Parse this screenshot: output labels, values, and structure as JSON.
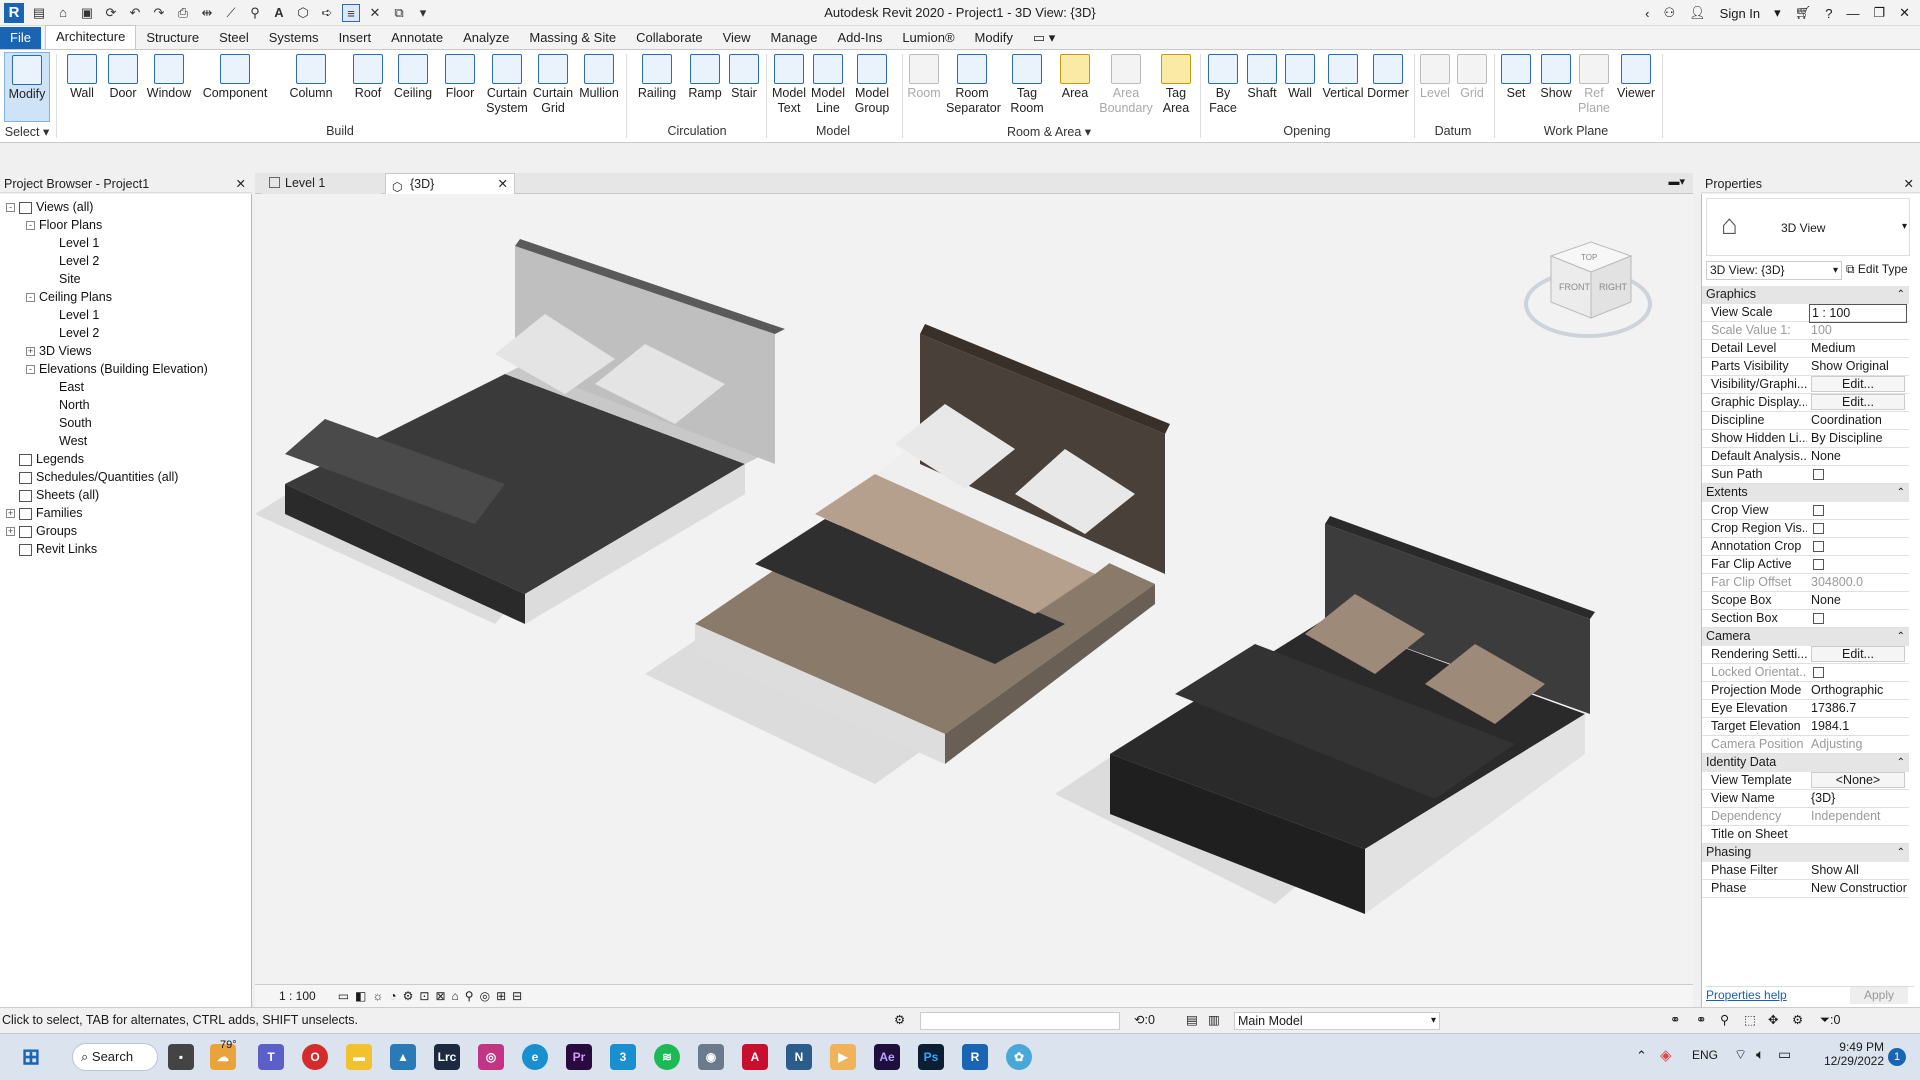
{
  "app": {
    "title": "Autodesk Revit 2020 - Project1 - 3D View: {3D}",
    "sign_in": "Sign In"
  },
  "ribbon_tabs": [
    "File",
    "Architecture",
    "Structure",
    "Steel",
    "Systems",
    "Insert",
    "Annotate",
    "Analyze",
    "Massing & Site",
    "Collaborate",
    "View",
    "Manage",
    "Add-Ins",
    "Lumion®",
    "Modify"
  ],
  "ribbon": {
    "select": {
      "modify": "Modify",
      "label": "Select"
    },
    "build": {
      "wall": "Wall",
      "door": "Door",
      "window": "Window",
      "component": "Component",
      "column": "Column",
      "roof": "Roof",
      "ceiling": "Ceiling",
      "floor": "Floor",
      "curtain_system": "Curtain System",
      "curtain_grid": "Curtain Grid",
      "mullion": "Mullion",
      "label": "Build"
    },
    "circulation": {
      "railing": "Railing",
      "ramp": "Ramp",
      "stair": "Stair",
      "label": "Circulation"
    },
    "model": {
      "model_text": "Model Text",
      "model_line": "Model Line",
      "model_group": "Model Group",
      "label": "Model"
    },
    "room_area": {
      "room": "Room",
      "room_separator": "Room Separator",
      "tag_room": "Tag Room",
      "area": "Area",
      "area_boundary": "Area Boundary",
      "tag_area": "Tag Area",
      "label": "Room & Area"
    },
    "opening": {
      "by_face": "By Face",
      "shaft": "Shaft",
      "wall": "Wall",
      "vertical": "Vertical",
      "dormer": "Dormer",
      "label": "Opening"
    },
    "datum": {
      "level": "Level",
      "grid": "Grid",
      "label": "Datum"
    },
    "work_plane": {
      "set": "Set",
      "show": "Show",
      "ref_plane": "Ref Plane",
      "viewer": "Viewer",
      "label": "Work Plane"
    }
  },
  "project_browser": {
    "title": "Project Browser - Project1",
    "items": [
      {
        "label": "Views (all)",
        "depth": 0,
        "toggle": "-"
      },
      {
        "label": "Floor Plans",
        "depth": 1,
        "toggle": "-"
      },
      {
        "label": "Level 1",
        "depth": 2,
        "toggle": ""
      },
      {
        "label": "Level 2",
        "depth": 2,
        "toggle": ""
      },
      {
        "label": "Site",
        "depth": 2,
        "toggle": ""
      },
      {
        "label": "Ceiling Plans",
        "depth": 1,
        "toggle": "-"
      },
      {
        "label": "Level 1",
        "depth": 2,
        "toggle": ""
      },
      {
        "label": "Level 2",
        "depth": 2,
        "toggle": ""
      },
      {
        "label": "3D Views",
        "depth": 1,
        "toggle": "+"
      },
      {
        "label": "Elevations (Building Elevation)",
        "depth": 1,
        "toggle": "-"
      },
      {
        "label": "East",
        "depth": 2,
        "toggle": ""
      },
      {
        "label": "North",
        "depth": 2,
        "toggle": ""
      },
      {
        "label": "South",
        "depth": 2,
        "toggle": ""
      },
      {
        "label": "West",
        "depth": 2,
        "toggle": ""
      },
      {
        "label": "Legends",
        "depth": 0,
        "toggle": ""
      },
      {
        "label": "Schedules/Quantities (all)",
        "depth": 0,
        "toggle": ""
      },
      {
        "label": "Sheets (all)",
        "depth": 0,
        "toggle": ""
      },
      {
        "label": "Families",
        "depth": 0,
        "toggle": "+"
      },
      {
        "label": "Groups",
        "depth": 0,
        "toggle": "+"
      },
      {
        "label": "Revit Links",
        "depth": 0,
        "toggle": ""
      }
    ]
  },
  "view_tabs": [
    "Level 1",
    "{3D}"
  ],
  "view_control": {
    "scale": "1 : 100"
  },
  "viewcube": {
    "front": "FRONT",
    "right": "RIGHT",
    "top": "TOP"
  },
  "properties": {
    "title": "Properties",
    "type_name": "3D View",
    "selector": "3D View: {3D}",
    "edit_type": "Edit Type",
    "sections": [
      {
        "name": "Graphics",
        "rows": [
          {
            "k": "View Scale",
            "v": "1 : 100"
          },
          {
            "k": "Scale Value 1:",
            "v": "100",
            "dis": true
          },
          {
            "k": "Detail Level",
            "v": "Medium"
          },
          {
            "k": "Parts Visibility",
            "v": "Show Original"
          },
          {
            "k": "Visibility/Graphi...",
            "v": "Edit...",
            "btn": true
          },
          {
            "k": "Graphic Display...",
            "v": "Edit...",
            "btn": true
          },
          {
            "k": "Discipline",
            "v": "Coordination"
          },
          {
            "k": "Show Hidden Li...",
            "v": "By Discipline"
          },
          {
            "k": "Default Analysis...",
            "v": "None"
          },
          {
            "k": "Sun Path",
            "v": "",
            "cb": true
          }
        ]
      },
      {
        "name": "Extents",
        "rows": [
          {
            "k": "Crop View",
            "v": "",
            "cb": true
          },
          {
            "k": "Crop Region Vis...",
            "v": "",
            "cb": true
          },
          {
            "k": "Annotation Crop",
            "v": "",
            "cb": true
          },
          {
            "k": "Far Clip Active",
            "v": "",
            "cb": true
          },
          {
            "k": "Far Clip Offset",
            "v": "304800.0",
            "dis": true
          },
          {
            "k": "Scope Box",
            "v": "None"
          },
          {
            "k": "Section Box",
            "v": "",
            "cb": true
          }
        ]
      },
      {
        "name": "Camera",
        "rows": [
          {
            "k": "Rendering Setti...",
            "v": "Edit...",
            "btn": true
          },
          {
            "k": "Locked Orientat...",
            "v": "",
            "cb": true,
            "dis": true
          },
          {
            "k": "Projection Mode",
            "v": "Orthographic"
          },
          {
            "k": "Eye Elevation",
            "v": "17386.7"
          },
          {
            "k": "Target Elevation",
            "v": "1984.1"
          },
          {
            "k": "Camera Position",
            "v": "Adjusting",
            "dis": true
          }
        ]
      },
      {
        "name": "Identity Data",
        "rows": [
          {
            "k": "View Template",
            "v": "<None>",
            "btn": true
          },
          {
            "k": "View Name",
            "v": "{3D}"
          },
          {
            "k": "Dependency",
            "v": "Independent",
            "dis": true
          },
          {
            "k": "Title on Sheet",
            "v": ""
          }
        ]
      },
      {
        "name": "Phasing",
        "rows": [
          {
            "k": "Phase Filter",
            "v": "Show All"
          },
          {
            "k": "Phase",
            "v": "New Construction"
          }
        ]
      }
    ],
    "help": "Properties help",
    "apply": "Apply"
  },
  "status": {
    "hint": "Click to select, TAB for alternates, CTRL adds, SHIFT unselects.",
    "workset_count": ":0",
    "model": "Main Model",
    "filter_count": ":0"
  },
  "taskbar": {
    "search": "Search",
    "weather": "79°",
    "lang": "ENG",
    "time": "9:49 PM",
    "date": "12/29/2022",
    "notif": "1"
  }
}
